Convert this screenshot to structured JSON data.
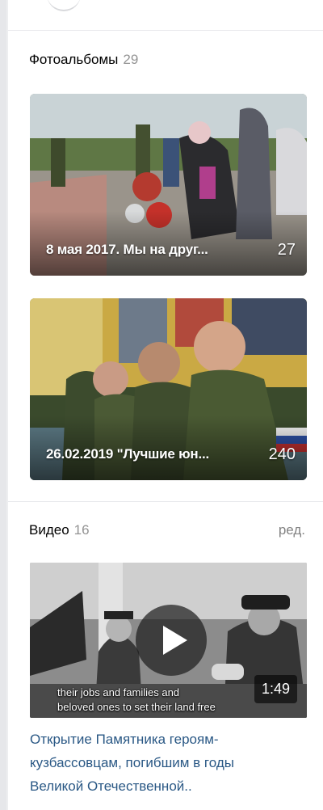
{
  "photo_albums": {
    "heading": "Фотоальбомы",
    "count": "29",
    "albums": [
      {
        "title": "8 мая 2017. Мы на друг...",
        "count": "27"
      },
      {
        "title": "26.02.2019 \"Лучшие юн...",
        "count": "240"
      }
    ]
  },
  "videos": {
    "heading": "Видео",
    "count": "16",
    "edit_label": "ред.",
    "items": [
      {
        "subtitle_line1": "their jobs and families and",
        "subtitle_line2": "beloved ones to set their land free",
        "duration": "1:49",
        "title_line1": "Открытие Памятника героям-",
        "title_line2": "кузбассовцам, погибшим в годы",
        "title_line3": "Великой Отечественной.."
      }
    ]
  },
  "colors": {
    "link": "#2a5885",
    "muted": "#939393",
    "page_bg": "#edeef0"
  }
}
